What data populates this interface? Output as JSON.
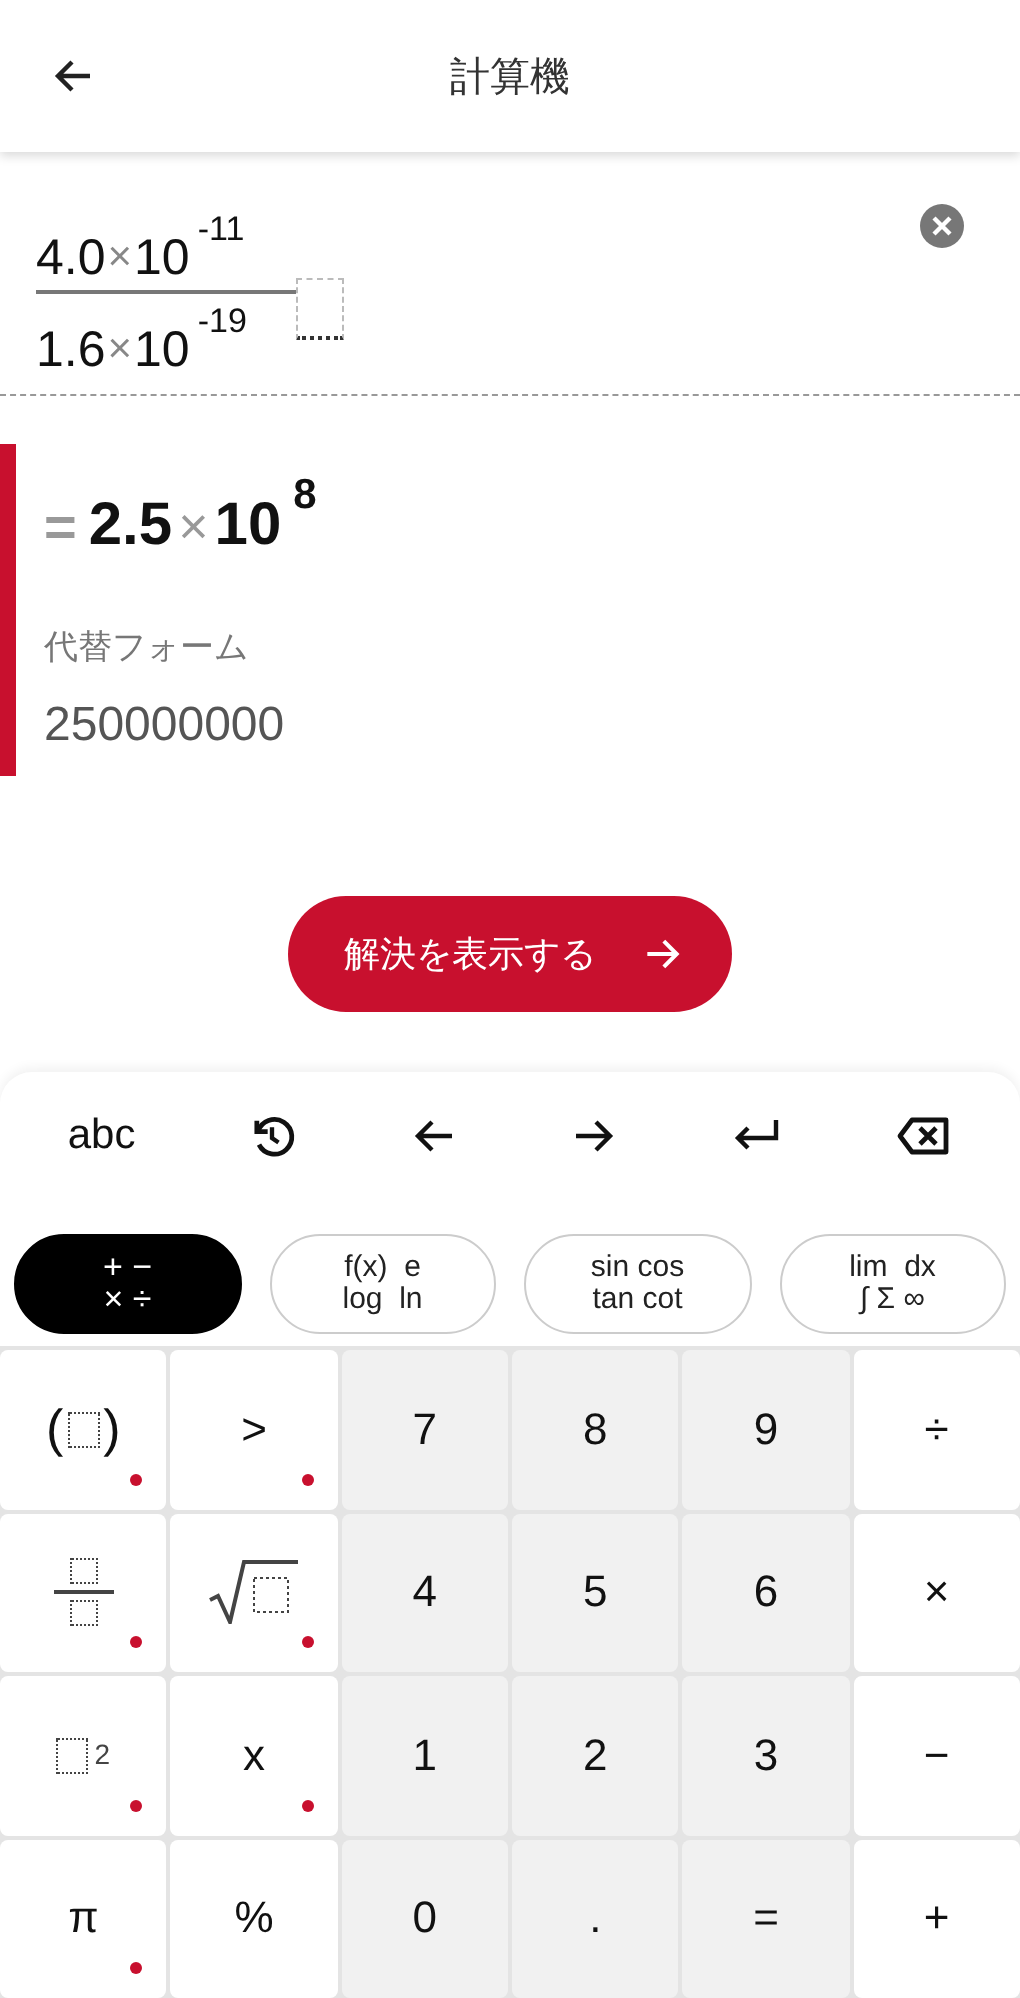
{
  "header": {
    "title": "計算機"
  },
  "expression": {
    "numerator": {
      "mantissa": "4.0",
      "times": "×",
      "base": "10",
      "exponent": "-11"
    },
    "denominator": {
      "mantissa": "1.6",
      "times": "×",
      "base": "10",
      "exponent": "-19"
    }
  },
  "result": {
    "equals": "=",
    "mantissa": "2.5",
    "times": "×",
    "base": "10",
    "exponent": "8",
    "alt_label": "代替フォーム",
    "alt_value": "250000000"
  },
  "solve_button": {
    "label": "解決を表示する"
  },
  "toolbar": {
    "label": "abc"
  },
  "categories": [
    {
      "lines": [
        "+ −",
        "× ÷"
      ],
      "selected": true
    },
    {
      "lines": [
        "f(x)  e",
        "log  ln"
      ],
      "selected": false
    },
    {
      "lines": [
        "sin cos",
        "tan cot"
      ],
      "selected": false
    },
    {
      "lines": [
        "lim  dx",
        "∫ Σ ∞"
      ],
      "selected": false
    }
  ],
  "keys": [
    {
      "kind": "paren",
      "label": "(",
      "label2": ")",
      "more": true
    },
    {
      "kind": "symbol",
      "label": ">",
      "more": true
    },
    {
      "kind": "digit",
      "label": "7",
      "more": false
    },
    {
      "kind": "digit",
      "label": "8",
      "more": false
    },
    {
      "kind": "digit",
      "label": "9",
      "more": false
    },
    {
      "kind": "symbol",
      "label": "÷",
      "more": false
    },
    {
      "kind": "fraction",
      "more": true
    },
    {
      "kind": "sqrt",
      "more": true
    },
    {
      "kind": "digit",
      "label": "4",
      "more": false
    },
    {
      "kind": "digit",
      "label": "5",
      "more": false
    },
    {
      "kind": "digit",
      "label": "6",
      "more": false
    },
    {
      "kind": "symbol",
      "label": "×",
      "more": false
    },
    {
      "kind": "square",
      "label": "2",
      "more": true
    },
    {
      "kind": "symbol",
      "label": "x",
      "more": true
    },
    {
      "kind": "digit",
      "label": "1",
      "more": false
    },
    {
      "kind": "digit",
      "label": "2",
      "more": false
    },
    {
      "kind": "digit",
      "label": "3",
      "more": false
    },
    {
      "kind": "symbol",
      "label": "−",
      "more": false
    },
    {
      "kind": "symbol",
      "label": "π",
      "more": true
    },
    {
      "kind": "symbol",
      "label": "%",
      "more": false
    },
    {
      "kind": "digit",
      "label": "0",
      "more": false
    },
    {
      "kind": "digit",
      "label": ".",
      "more": false
    },
    {
      "kind": "digit",
      "label": "=",
      "more": false
    },
    {
      "kind": "symbol",
      "label": "+",
      "more": false
    }
  ]
}
